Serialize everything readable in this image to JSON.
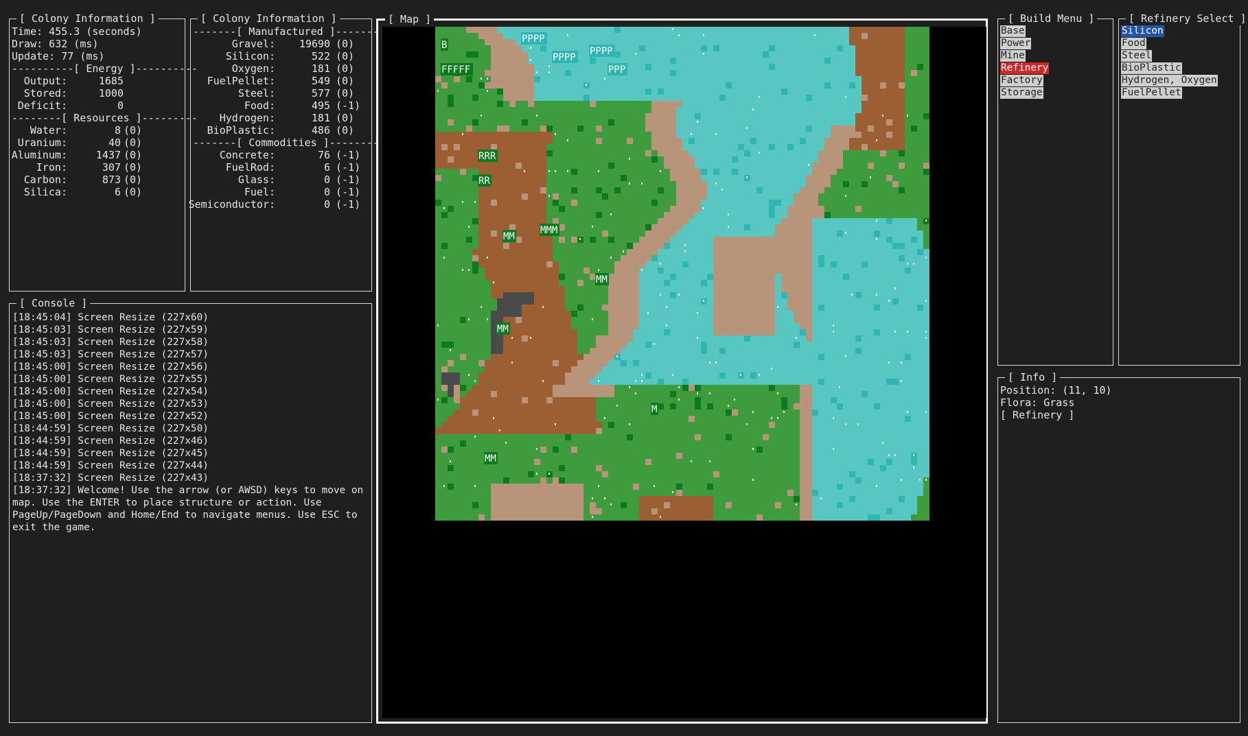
{
  "colony_info_1": {
    "title": "[ Colony Information ]",
    "time": "Time: 455.3 (seconds)",
    "draw": "Draw: 632 (ms)",
    "update": "Update: 77 (ms)",
    "energy_header": "----------[ Energy ]----------",
    "energy": [
      {
        "label": "Output:",
        "value": "1685"
      },
      {
        "label": "Stored:",
        "value": "1000"
      },
      {
        "label": "Deficit:",
        "value": "0"
      }
    ],
    "resources_header": "--------[ Resources ]---------",
    "resources": [
      {
        "label": "Water:",
        "value": "8",
        "delta": "(0)"
      },
      {
        "label": "Uranium:",
        "value": "40",
        "delta": "(0)"
      },
      {
        "label": "Aluminum:",
        "value": "1437",
        "delta": "(0)"
      },
      {
        "label": "Iron:",
        "value": "307",
        "delta": "(0)"
      },
      {
        "label": "Carbon:",
        "value": "873",
        "delta": "(0)"
      },
      {
        "label": "Silica:",
        "value": "6",
        "delta": "(0)"
      }
    ]
  },
  "colony_info_2": {
    "title": "[ Colony Information ]",
    "manufactured_header": "-------[ Manufactured ]-------",
    "manufactured": [
      {
        "label": "Gravel:",
        "value": "19690",
        "delta": "(0)"
      },
      {
        "label": "Silicon:",
        "value": "522",
        "delta": "(0)"
      },
      {
        "label": "Oxygen:",
        "value": "181",
        "delta": "(0)"
      },
      {
        "label": "FuelPellet:",
        "value": "549",
        "delta": "(0)"
      },
      {
        "label": "Steel:",
        "value": "577",
        "delta": "(0)"
      },
      {
        "label": "Food:",
        "value": "495",
        "delta": "(-1)"
      },
      {
        "label": "Hydrogen:",
        "value": "181",
        "delta": "(0)"
      },
      {
        "label": "BioPlastic:",
        "value": "486",
        "delta": "(0)"
      }
    ],
    "commodities_header": "-------[ Commodities ]--------",
    "commodities": [
      {
        "label": "Concrete:",
        "value": "76",
        "delta": "(-1)"
      },
      {
        "label": "FuelRod:",
        "value": "6",
        "delta": "(-1)"
      },
      {
        "label": "Glass:",
        "value": "0",
        "delta": "(-1)"
      },
      {
        "label": "Fuel:",
        "value": "0",
        "delta": "(-1)"
      },
      {
        "label": "Semiconductor:",
        "value": "0",
        "delta": "(-1)"
      }
    ]
  },
  "console": {
    "title": "[ Console ]",
    "lines": [
      "[18:45:04] Screen Resize (227x60)",
      "[18:45:03] Screen Resize (227x59)",
      "[18:45:03] Screen Resize (227x58)",
      "[18:45:03] Screen Resize (227x57)",
      "[18:45:00] Screen Resize (227x56)",
      "[18:45:00] Screen Resize (227x55)",
      "[18:45:00] Screen Resize (227x54)",
      "[18:45:00] Screen Resize (227x53)",
      "[18:45:00] Screen Resize (227x52)",
      "[18:44:59] Screen Resize (227x50)",
      "[18:44:59] Screen Resize (227x46)",
      "[18:44:59] Screen Resize (227x45)",
      "[18:44:59] Screen Resize (227x44)",
      "[18:37:32] Screen Resize (227x43)",
      "[18:37:32] Welcome! Use the arrow (or AWSD) keys to move on map. Use the ENTER to place structure or action. Use PageUp/PageDown and Home/End to navigate menus. Use ESC to exit the game."
    ]
  },
  "map": {
    "title": "[ Map ]",
    "labels": [
      {
        "text": "PPPP"
      },
      {
        "text": "PPPP"
      },
      {
        "text": "PPPP"
      },
      {
        "text": "PPP"
      },
      {
        "text": "B"
      },
      {
        "text": "FFFFF"
      },
      {
        "text": "RRR"
      },
      {
        "text": "RR"
      },
      {
        "text": "MMM"
      },
      {
        "text": "MM"
      },
      {
        "text": "MM"
      },
      {
        "text": "MM"
      },
      {
        "text": "MM"
      },
      {
        "text": "M"
      }
    ]
  },
  "build_menu": {
    "title": "[ Build Menu ]",
    "items": [
      "Base",
      "Power",
      "Mine",
      "Refinery",
      "Factory",
      "Storage"
    ],
    "selected": "Refinery"
  },
  "refinery_select": {
    "title": "[ Refinery Select ]",
    "items": [
      "Silicon",
      "Food",
      "Steel",
      "BioPlastic",
      "Hydrogen, Oxygen",
      "FuelPellet"
    ],
    "selected": "Silicon"
  },
  "info": {
    "title": "[ Info ]",
    "position": "Position: (11, 10)",
    "flora": "Flora: Grass",
    "structure": "[ Refinery ]"
  },
  "colors": {
    "background": "#1f1f1f",
    "grass": "#3e9c3e",
    "forest": "#0d7a1f",
    "water": "#58c6c1",
    "water_deep": "#2fb5b2",
    "sand": "#b8957a",
    "dirt": "#9c5f34",
    "rock": "#4a4a4a",
    "menu_selected": "#cc2a2a",
    "select_selected": "#2455a8"
  }
}
